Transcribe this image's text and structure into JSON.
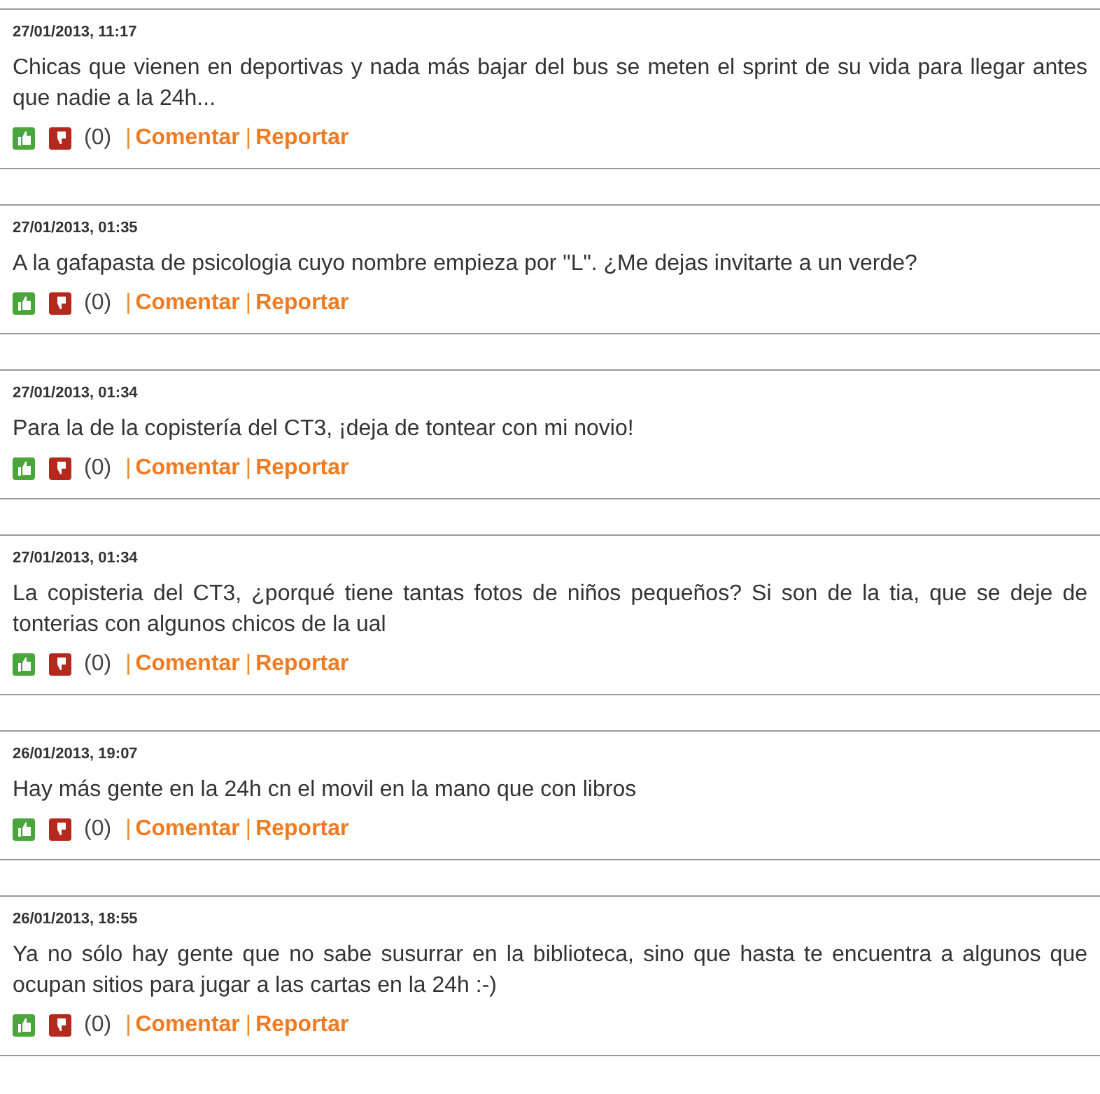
{
  "posts": [
    {
      "date": "27/01/2013, 11:17",
      "text": "Chicas que vienen en deportivas y nada más bajar del bus se meten el sprint de su vida para llegar antes que nadie a la 24h...",
      "votes": "(0)",
      "separator_1": "|",
      "comment": "Comentar",
      "separator_2": "|",
      "report": "Reportar"
    },
    {
      "date": "27/01/2013, 01:35",
      "text": "A la gafapasta de psicologia cuyo nombre empieza por \"L\". ¿Me dejas invitarte a un verde?",
      "votes": "(0)",
      "separator_1": "|",
      "comment": "Comentar",
      "separator_2": "|",
      "report": "Reportar"
    },
    {
      "date": "27/01/2013, 01:34",
      "text": "Para la de la copistería del CT3, ¡deja de tontear con mi novio!",
      "votes": "(0)",
      "separator_1": "|",
      "comment": "Comentar",
      "separator_2": "|",
      "report": "Reportar"
    },
    {
      "date": "27/01/2013, 01:34",
      "text": "La copisteria del CT3, ¿porqué tiene tantas fotos de niños pequeños? Si son de la tia, que se deje de tonterias con algunos chicos de la ual",
      "votes": "(0)",
      "separator_1": "|",
      "comment": "Comentar",
      "separator_2": "|",
      "report": "Reportar"
    },
    {
      "date": "26/01/2013, 19:07",
      "text": "Hay más gente en la 24h cn el movil en la mano que con libros",
      "votes": "(0)",
      "separator_1": "|",
      "comment": "Comentar",
      "separator_2": "|",
      "report": "Reportar"
    },
    {
      "date": "26/01/2013, 18:55",
      "text": "Ya no sólo hay gente que no sabe susurrar en la biblioteca, sino que hasta te encuentra a algunos que ocupan sitios para jugar a las cartas en la 24h :-)",
      "votes": "(0)",
      "separator_1": "|",
      "comment": "Comentar",
      "separator_2": "|",
      "report": "Reportar"
    }
  ]
}
